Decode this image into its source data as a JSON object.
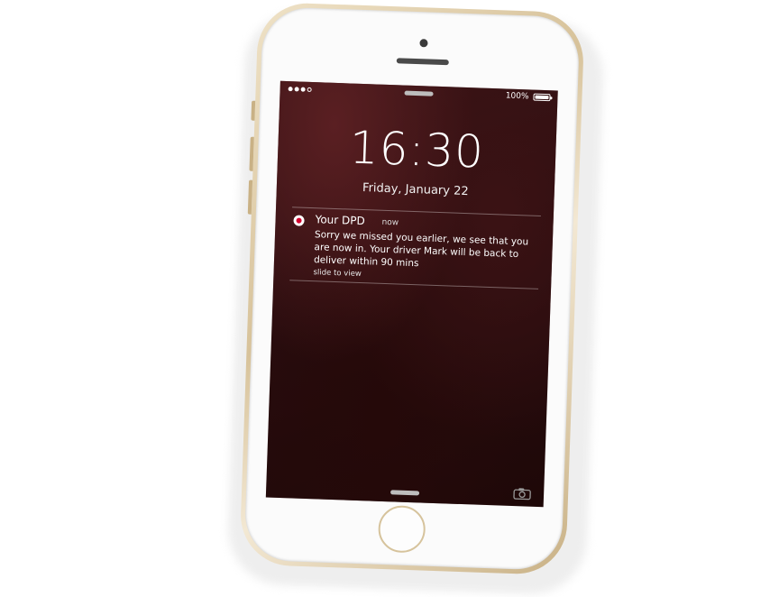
{
  "status_bar": {
    "signal_dots_filled": 3,
    "signal_dots_total": 4,
    "battery_text": "100%",
    "battery_level_percent": 100
  },
  "lock_screen": {
    "time": "16:30",
    "date": "Friday, January 22"
  },
  "notification": {
    "app_name": "Your DPD",
    "time": "now",
    "message": "Sorry we missed you earlier, we see that you are now in. Your driver Mark will be back to deliver within 90 mins",
    "action_hint": "slide to view",
    "icon": "dpd-app-icon",
    "icon_color": "#d3002e"
  },
  "icons": {
    "camera": "camera-icon",
    "battery": "battery-icon",
    "signal": "signal-icon"
  },
  "colors": {
    "phone_frame": "#d7c29a",
    "phone_face": "#fbfbfb",
    "wallpaper": "#2a0d0f"
  }
}
